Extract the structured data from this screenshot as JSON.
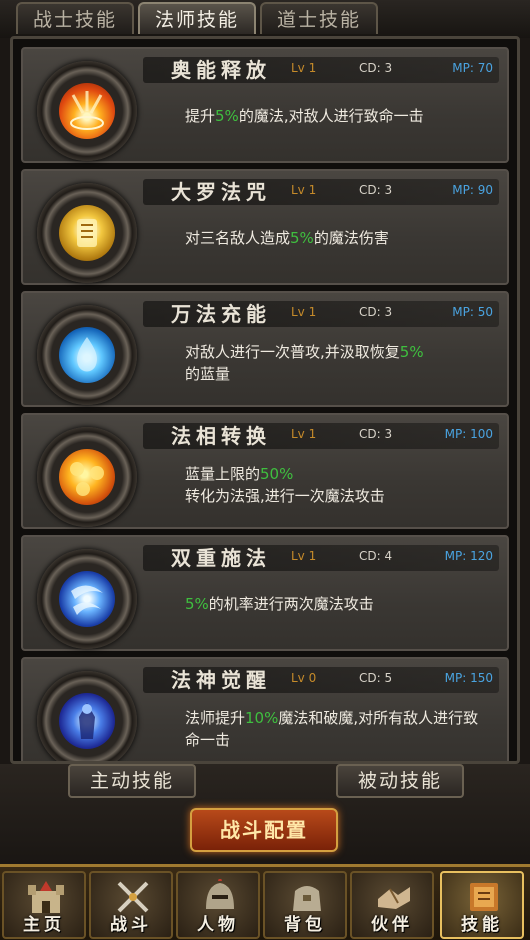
{
  "tabs": [
    {
      "label": "战士技能",
      "active": false
    },
    {
      "label": "法师技能",
      "active": true
    },
    {
      "label": "道士技能",
      "active": false
    }
  ],
  "skills": [
    {
      "name": "奥能释放",
      "lv": "Lv 1",
      "cd": "CD: 3",
      "mp": "MP: 70",
      "desc_pre": "提升",
      "pct": "5%",
      "desc_post": "的魔法,对敌人进行致命一击",
      "icon": "arcane-release-icon"
    },
    {
      "name": "大罗法咒",
      "lv": "Lv 1",
      "cd": "CD: 3",
      "mp": "MP: 90",
      "desc_pre": "对三名敌人造成",
      "pct": "5%",
      "desc_post": "的魔法伤害",
      "icon": "great-spell-icon"
    },
    {
      "name": "万法充能",
      "lv": "Lv 1",
      "cd": "CD: 3",
      "mp": "MP: 50",
      "desc_pre": "对敌人进行一次普攻,并汲取恢复",
      "pct": "5%",
      "desc_post": "的蓝量",
      "icon": "mana-charge-icon"
    },
    {
      "name": "法相转换",
      "lv": "Lv 1",
      "cd": "CD: 3",
      "mp": "MP: 100",
      "desc_pre": "蓝量上限的",
      "pct": "50%",
      "desc_post": "转化为法强,进行一次魔法攻击",
      "icon": "mana-convert-icon"
    },
    {
      "name": "双重施法",
      "lv": "Lv 1",
      "cd": "CD: 4",
      "mp": "MP: 120",
      "desc_pre": "",
      "pct": "5%",
      "desc_post": "的机率进行两次魔法攻击",
      "icon": "double-cast-icon"
    },
    {
      "name": "法神觉醒",
      "lv": "Lv 0",
      "cd": "CD: 5",
      "mp": "MP: 150",
      "desc_pre": "法师提升",
      "pct": "10%",
      "desc_post": "魔法和破魔,对所有敌人进行致命一击",
      "icon": "mage-awakening-icon"
    }
  ],
  "buttons": {
    "active_skills": "主动技能",
    "passive_skills": "被动技能",
    "battle_config": "战斗配置"
  },
  "nav": [
    {
      "label": "主页",
      "icon": "castle-icon",
      "active": false
    },
    {
      "label": "战斗",
      "icon": "crossed-swords-icon",
      "active": false
    },
    {
      "label": "人物",
      "icon": "helmet-icon",
      "active": false
    },
    {
      "label": "背包",
      "icon": "bag-icon",
      "active": false
    },
    {
      "label": "伙伴",
      "icon": "handshake-icon",
      "active": false
    },
    {
      "label": "技能",
      "icon": "skill-book-icon",
      "active": true
    }
  ],
  "colors": {
    "highlight_green": "#3fbf3f",
    "level_orange": "#c58a2a",
    "mp_blue": "#4aa3e0"
  }
}
